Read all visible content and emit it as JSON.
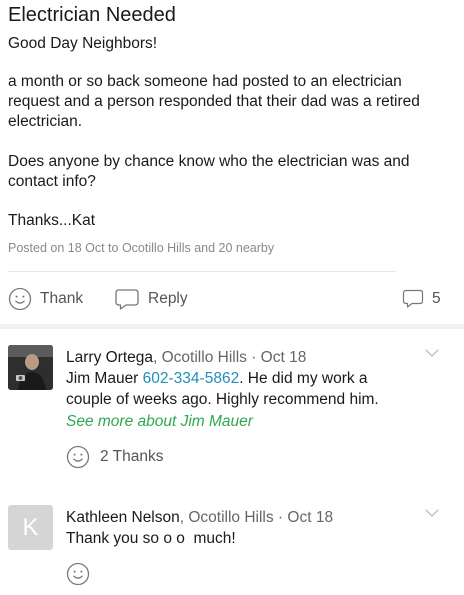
{
  "post": {
    "title": "Electrician Needed",
    "greeting": "Good Day Neighbors!",
    "paragraph1": "a month or so back someone had posted to an electrician request and a person responded that their dad was a retired electrician.",
    "paragraph2": "Does anyone by chance know who the electrician was and contact info?",
    "signoff": "Thanks...Kat",
    "meta": "Posted on 18 Oct to Ocotillo Hills and 20 nearby"
  },
  "actions": {
    "thank_label": "Thank",
    "reply_label": "Reply",
    "reply_count": "5",
    "thank_icon": "smiley-icon",
    "reply_icon": "speech-bubble-icon"
  },
  "comments": [
    {
      "author": "Larry Ortega",
      "subtitle": ", Ocotillo Hills · Oct 18",
      "text_before": "Jim Mauer ",
      "phone": "602-334-5862",
      "text_after": ". He did my work a couple of weeks ago. Highly recommend him.",
      "see_more": "See more about Jim Mauer",
      "thanks": "2 Thanks"
    },
    {
      "author": "Kathleen Nelson",
      "subtitle": ", Ocotillo Hills · Oct 18",
      "avatar_letter": "K",
      "text": "Thank you so o o  much!"
    }
  ],
  "colors": {
    "link_phone": "#1f8fb8",
    "see_more": "#2fa84f",
    "muted": "#8a8a8a"
  }
}
